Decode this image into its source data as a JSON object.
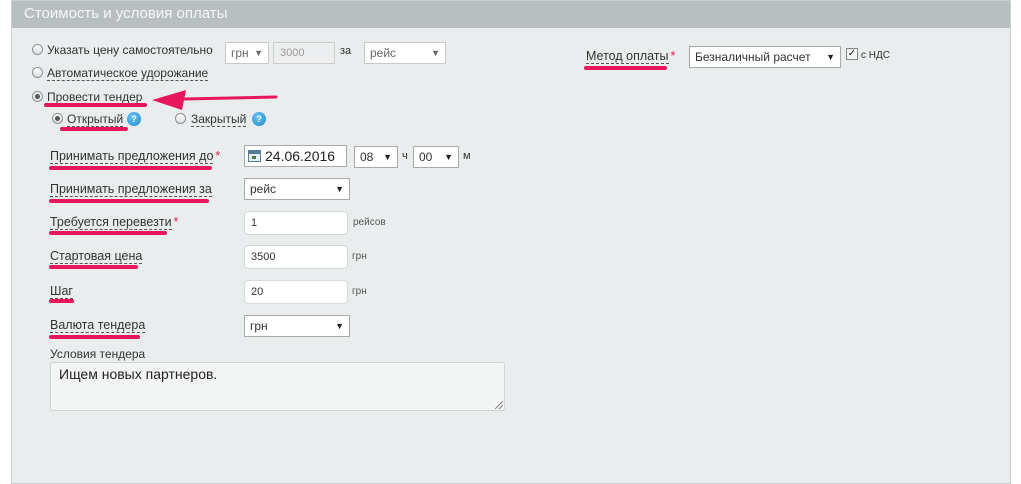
{
  "header": {
    "title": "Стоимость и условия оплаты"
  },
  "price_mode": {
    "manual": {
      "label": "Указать цену самостоятельно",
      "currency": "грн",
      "price_placeholder": "3000",
      "per_label": "за",
      "per_value": "рейс"
    },
    "auto": {
      "label": "Автоматическое удорожание"
    },
    "tender": {
      "label": "Провести тендер"
    }
  },
  "tender_type": {
    "open_label": "Открытый",
    "closed_label": "Закрытый",
    "help": "?"
  },
  "payment": {
    "label": "Метод оплаты",
    "value": "Безналичный расчет",
    "vat_label": "с НДС",
    "vat_checked": true
  },
  "form": {
    "deadline": {
      "label": "Принимать предложения до",
      "date": "24.06.2016",
      "hour": "08",
      "hour_unit": "ч",
      "minute": "00",
      "minute_unit": "м"
    },
    "offers_per": {
      "label": "Принимать предложения за",
      "value": "рейс"
    },
    "required": {
      "label": "Требуется перевезти",
      "value": "1",
      "unit": "рейсов"
    },
    "start_price": {
      "label": "Стартовая цена",
      "value": "3500",
      "unit": "грн"
    },
    "step": {
      "label": "Шаг",
      "value": "20",
      "unit": "грн"
    },
    "currency": {
      "label": "Валюта тендера",
      "value": "грн"
    },
    "conditions": {
      "label": "Условия тендера",
      "value": "Ищем новых партнеров."
    }
  },
  "required_mark": "*",
  "colors": {
    "annotation": "#e8175d",
    "header_bg": "#b9bfc1",
    "panel_bg": "#eaedee"
  }
}
